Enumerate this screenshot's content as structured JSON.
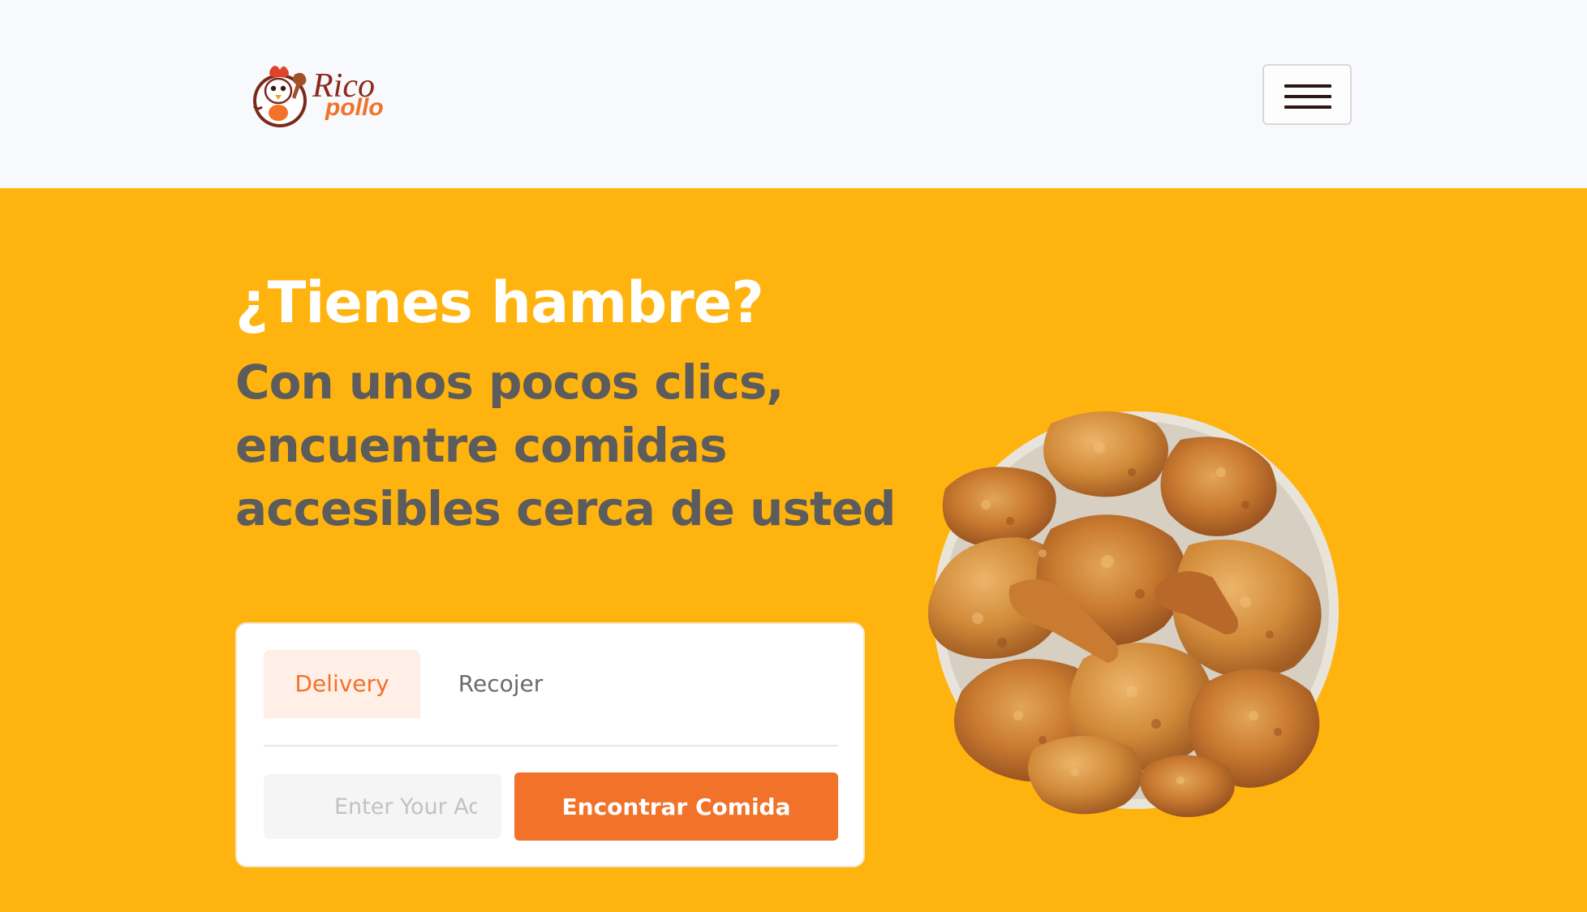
{
  "brand": {
    "logo_text_1": "Rico",
    "logo_text_2": "pollo",
    "icon": "chicken-mascot-icon"
  },
  "nav": {
    "menu_icon": "hamburger-menu-icon"
  },
  "hero": {
    "title": "¿Tienes hambre?",
    "subtitle_lines": [
      "Con unos pocos clics,",
      "encuentre comidas",
      "accesibles cerca de usted"
    ],
    "image_icon": "fried-chicken-plate-image"
  },
  "search": {
    "tabs": [
      {
        "label": "Delivery",
        "active": true
      },
      {
        "label": "Recojer",
        "active": false
      }
    ],
    "input_placeholder": "Enter Your Address",
    "submit_label": "Encontrar Comida"
  },
  "colors": {
    "background": "#FFB30E",
    "navbar": "#F8F9FC",
    "accent": "#F17228",
    "active_tab_bg": "#FFEFE7",
    "subtitle": "#5C5C5C",
    "title": "#FFFFFF"
  }
}
